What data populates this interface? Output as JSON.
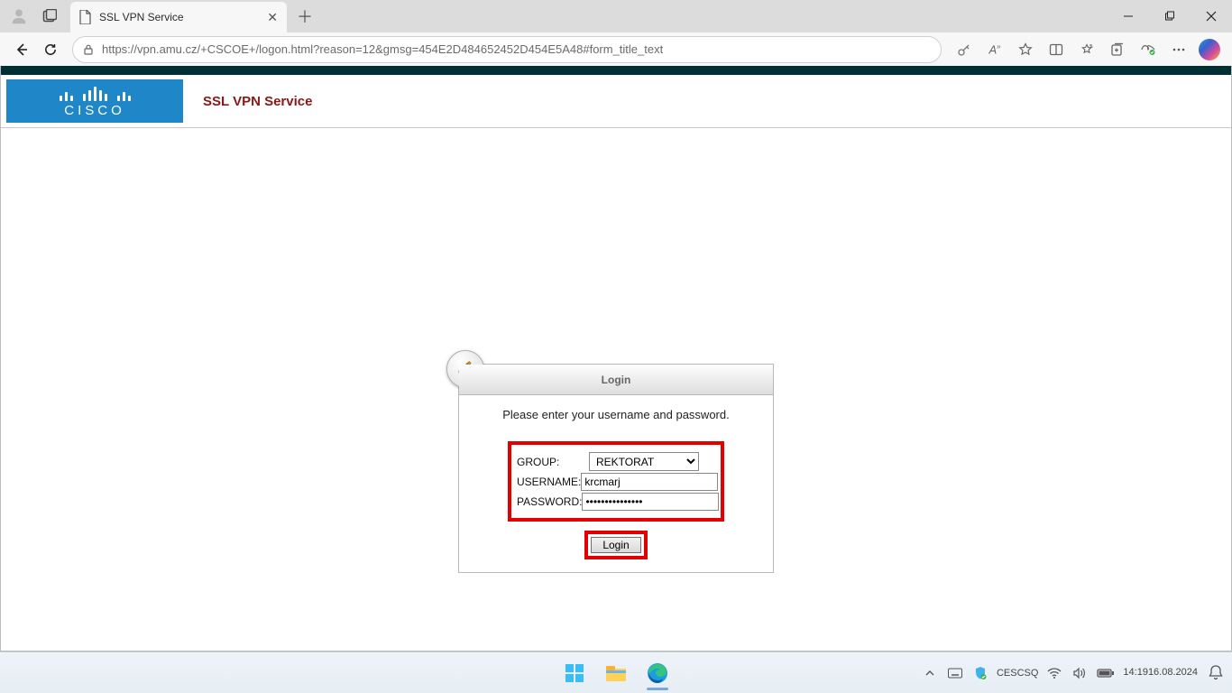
{
  "browser": {
    "tab_title": "SSL VPN Service",
    "url": "https://vpn.amu.cz/+CSCOE+/logon.html?reason=12&gmsg=454E2D484652452D454E5A48#form_title_text"
  },
  "page": {
    "title": "SSL VPN Service",
    "logo_text": "CISCO"
  },
  "login": {
    "header": "Login",
    "prompt": "Please enter your username and password.",
    "group_label": "GROUP:",
    "username_label": "USERNAME:",
    "password_label": "PASSWORD:",
    "group_value": "REKTORAT",
    "username_value": "krcmarj",
    "password_value": "•••••••••••••••",
    "login_button_label": "Login"
  },
  "taskbar": {
    "lang1": "CES",
    "lang2": "CSQ",
    "time": "14:19",
    "date": "16.08.2024"
  }
}
